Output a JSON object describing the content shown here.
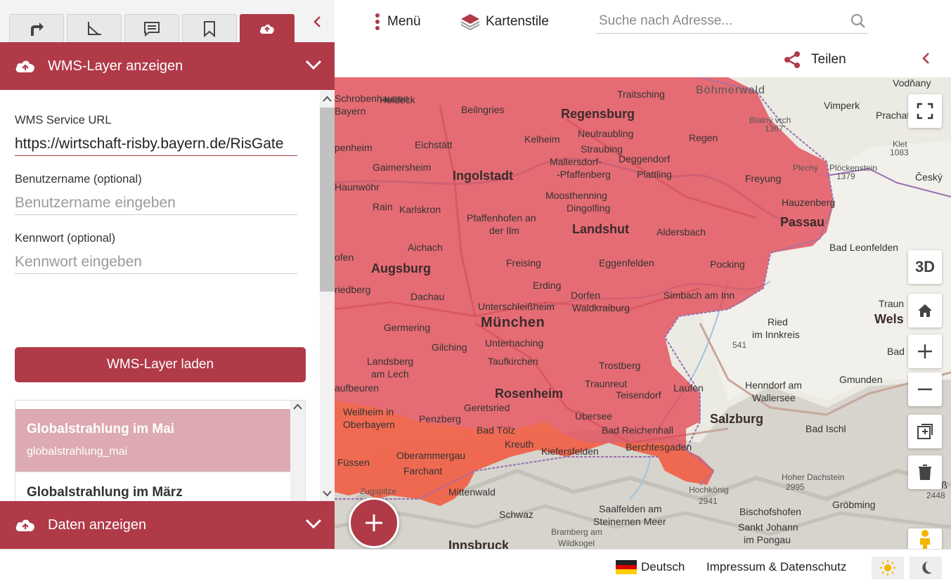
{
  "tabs": [
    {
      "name": "route-icon",
      "active": false
    },
    {
      "name": "measure-icon",
      "active": false
    },
    {
      "name": "comment-icon",
      "active": false
    },
    {
      "name": "bookmark-icon",
      "active": false
    },
    {
      "name": "cloud-upload-icon",
      "active": true
    }
  ],
  "header": {
    "menu_label": "Menü",
    "styles_label": "Kartenstile",
    "search_placeholder": "Suche nach Adresse...",
    "share_label": "Teilen"
  },
  "sidebar": {
    "wms_section_title": "WMS-Layer anzeigen",
    "url_label": "WMS Service URL",
    "url_value": "https://wirtschaft-risby.bayern.de/RisGate",
    "user_label": "Benutzername (optional)",
    "user_placeholder": "Benutzername eingeben",
    "pass_label": "Kennwort (optional)",
    "pass_placeholder": "Kennwort eingeben",
    "load_button": "WMS-Layer laden",
    "layers": [
      {
        "title": "Globalstrahlung im Mai",
        "id": "globalstrahlung_mai",
        "selected": true
      },
      {
        "title": "Globalstrahlung im März",
        "id": "globalstrahlung_maerz",
        "selected": false
      }
    ],
    "data_section_title": "Daten anzeigen"
  },
  "map": {
    "labels": {
      "regensburg": "Regensburg",
      "ingolstadt": "Ingolstadt",
      "augsburg": "Augsburg",
      "muenchen": "München",
      "landshut": "Landshut",
      "rosenheim": "Rosenheim",
      "passau": "Passau",
      "salzburg": "Salzburg",
      "innsbruck": "Innsbruck",
      "boehmerwald": "Böhmerwald",
      "deggendorf": "Deggendorf",
      "straubing": "Straubing",
      "kelheim": "Kelheim",
      "eichstaett": "Eichstätt",
      "freising": "Freising",
      "erding": "Erding",
      "dachau": "Dachau",
      "wels": "Wels",
      "bad_reichenhall": "Bad Reichenhall",
      "garmisch": "Farchant",
      "mittenwald": "Mittenwald",
      "bad_toelz": "Bad Tölz",
      "traunstein": "Traunreut",
      "vimperk": "Vimperk",
      "pocking": "Pocking",
      "ried": "Ried",
      "ried2": "im Innkreis",
      "gmunden": "Gmunden",
      "bad_ischl": "Bad Ischl",
      "bad_leonfelden": "Bad Leonfelden",
      "hauzenberg": "Hauzenberg",
      "oberammergau": "Oberammergau",
      "kreuth": "Kreuth",
      "penzberg": "Penzberg",
      "weilheim": "Weilheim in",
      "weilheim2": "Oberbayern",
      "landsberg": "Landsberg",
      "landsberg2": "am Lech",
      "germering": "Germering",
      "gilching": "Gilching",
      "unterhaching": "Unterhaching",
      "taufkirchen": "Taufkirchen",
      "unterschleissheim": "Unterschleißheim",
      "pfaffenhofen": "Pfaffenhofen an",
      "pfaffenhofen2": "der Ilm",
      "mainburg": "Mallersdorf-",
      "mainburg2": "-Pfaffenberg",
      "dingolfing": "Dingolfing",
      "moosthenning": "Moosthenning",
      "eggenfelden": "Eggenfelden",
      "simbach": "Simbach am Inn",
      "waldkraiburg": "Waldkraiburg",
      "dorfen": "Dorfen",
      "trostberg": "Trostberg",
      "laufen": "Laufen",
      "teisendorf": "Teisendorf",
      "uebersee": "Übersee",
      "berchtesgaden": "Berchtesgaden",
      "kiefersfelden": "Kiefersfelden",
      "saalfelden": "Saalfelden am",
      "saalfelden2": "Steinernen Meer",
      "bischofshofen": "Bischofshofen",
      "sankt_johann": "Sankt Johann",
      "sankt_johann2": "im Pongau",
      "hohe_dachstein": "Hoher Dachstein",
      "groebming": "Gröbming",
      "schwaz": "Schwaz",
      "bramberg": "Bramberg am",
      "bramberg2": "Wildkogel",
      "hochkoenig": "Hochkönig",
      "henndorf": "Henndorf am",
      "henndorf2": "Wallersee",
      "traun": "Traun",
      "aichach": "Aichach",
      "rain": "Rain",
      "karlskron": "Karlskron",
      "gaimersheim": "Gaimersheim",
      "beilngries": "Beilngries",
      "neutraubling": "Neutraubling",
      "regen": "Regen",
      "freyung": "Freyung",
      "plattling": "Plattling",
      "aldersbach": "Aldersbach",
      "traitsching": "Traitsching",
      "heideck": "Heideck",
      "fuessen": "Füssen",
      "geretsried": "Geretsried",
      "vodnany": "Vodňany",
      "prachatice": "Prachatice",
      "cesky": "Český",
      "bad_hall": "Bad Ha",
      "gross": "Groß",
      "zugspitze": "Zugspitze",
      "n2995": "2995",
      "n2941": "2941",
      "n2448": "2448",
      "n541": "541",
      "n1367": "1367",
      "n1083": "1083",
      "n1379": "1379",
      "klet": "Klet",
      "plockenstein": "Plöckenstein",
      "blatny": "Blatný vrch",
      "plechy": "Plechý",
      "haunwoehr": "Haunwöhr",
      "fen": "ofen",
      "ried_riedberg": "riedberg",
      "bayern": "Bayern",
      "rn_prefix": "Schrobenhausen",
      "aufbeuren": "aufbeuren",
      "penheim": "penheim"
    },
    "controls": {
      "label_3d": "3D"
    },
    "colors": {
      "overlay": "#e23a4a",
      "overlay_alps": "#f36a4a",
      "accent": "#b03a48"
    }
  },
  "footer": {
    "language": "Deutsch",
    "impressum": "Impressum & Datenschutz"
  }
}
